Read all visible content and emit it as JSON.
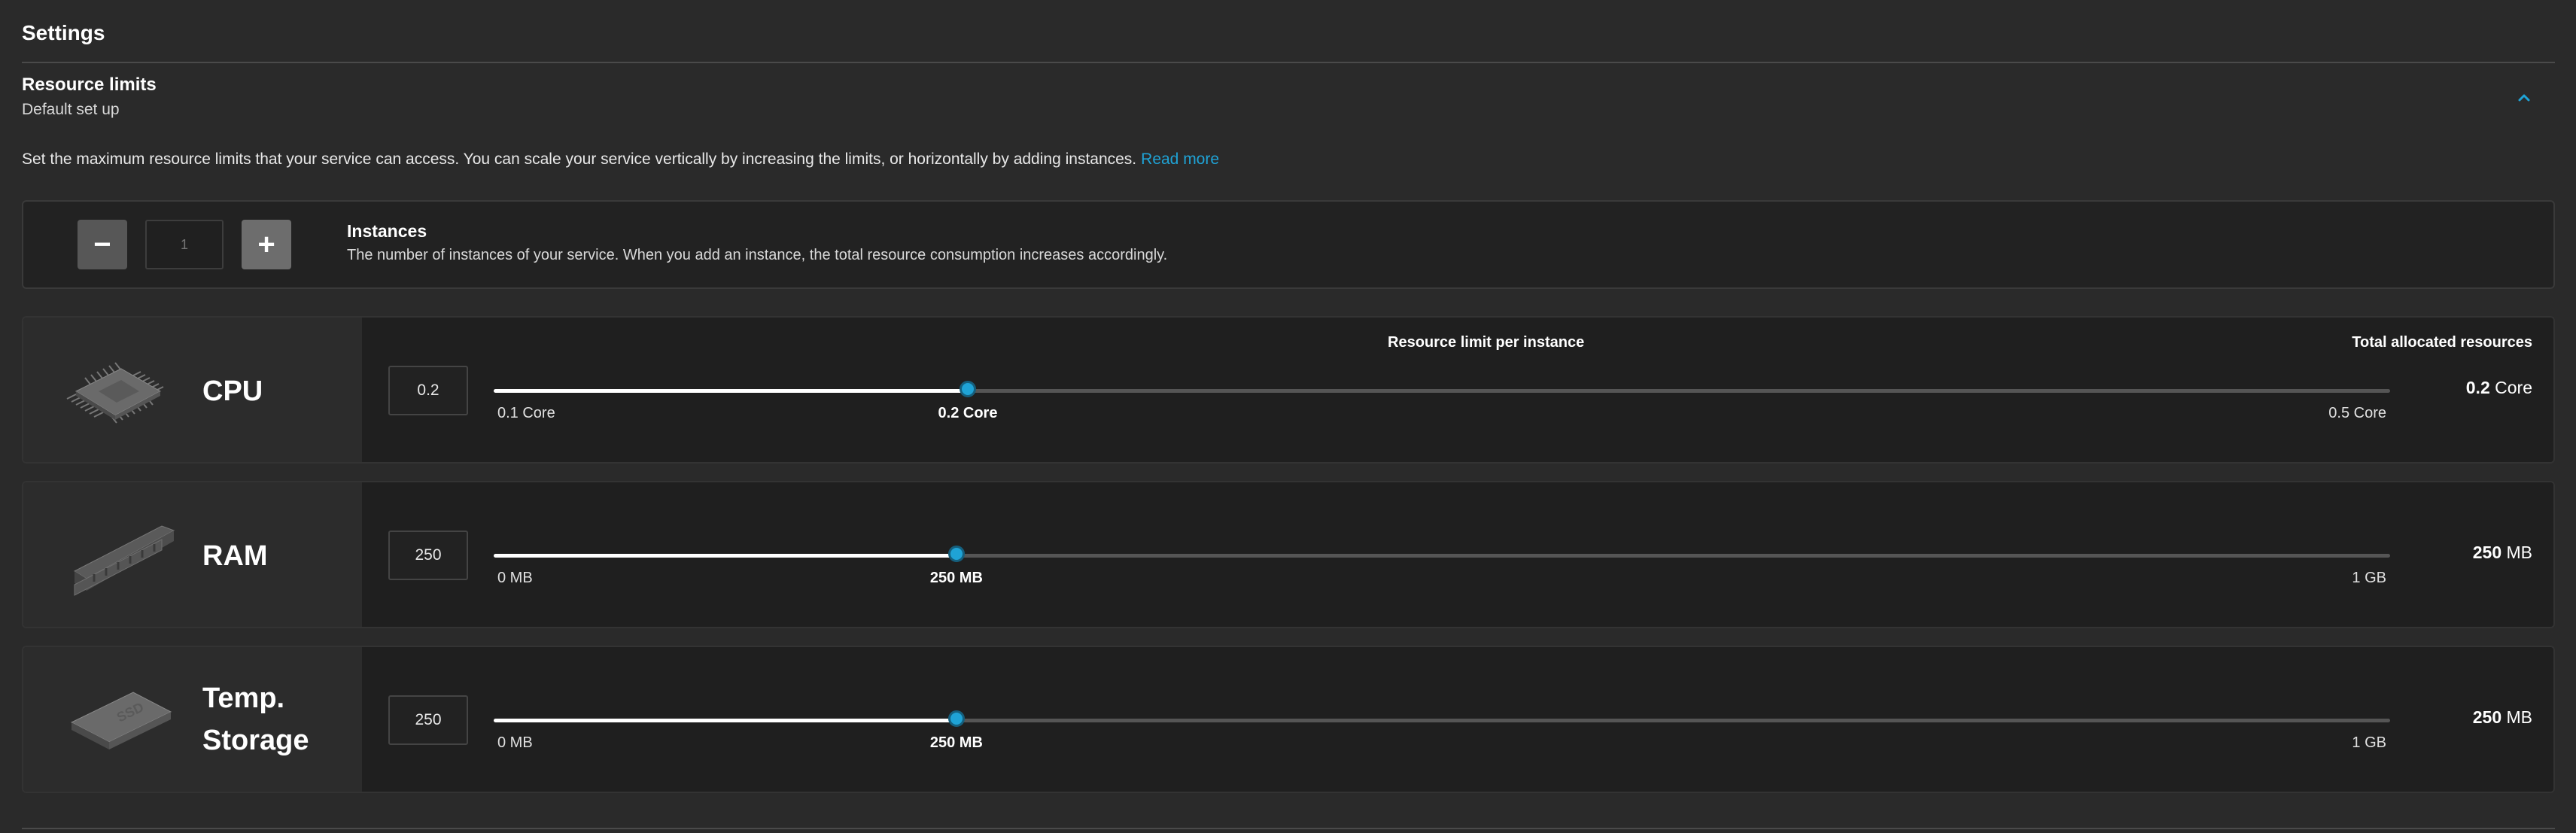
{
  "settings": {
    "title": "Settings",
    "section_title": "Resource limits",
    "section_subtitle": "Default set up",
    "description": "Set the maximum resource limits that your service can access. You can scale your service vertically by increasing the limits, or horizontally by adding instances.",
    "read_more": "Read more"
  },
  "instances": {
    "minus": "−",
    "plus": "+",
    "placeholder": "1",
    "title": "Instances",
    "description": "The number of instances of your service. When you add an instance, the total resource consumption increases accordingly."
  },
  "headers": {
    "per_instance": "Resource limit per instance",
    "total": "Total allocated resources"
  },
  "colors": {
    "accent": "#1fa3d6",
    "background": "#2a2a2a",
    "panel": "#1f1f1f"
  },
  "resources": {
    "cpu": {
      "label": "CPU",
      "icon": "cpu-chip-icon",
      "value": "0.2",
      "min_label": "0.1 Core",
      "current_label": "0.2 Core",
      "max_label": "0.5 Core",
      "fraction": 0.25,
      "total_value": "0.2",
      "total_unit": "Core"
    },
    "ram": {
      "label": "RAM",
      "icon": "ram-module-icon",
      "value": "250",
      "min_label": "0 MB",
      "current_label": "250 MB",
      "max_label": "1 GB",
      "fraction": 0.244,
      "total_value": "250",
      "total_unit": "MB"
    },
    "storage": {
      "label_line1": "Temp.",
      "label_line2": "Storage",
      "icon": "ssd-drive-icon",
      "icon_text": "SSD",
      "value": "250",
      "min_label": "0 MB",
      "current_label": "250 MB",
      "max_label": "1 GB",
      "fraction": 0.244,
      "total_value": "250",
      "total_unit": "MB"
    }
  }
}
